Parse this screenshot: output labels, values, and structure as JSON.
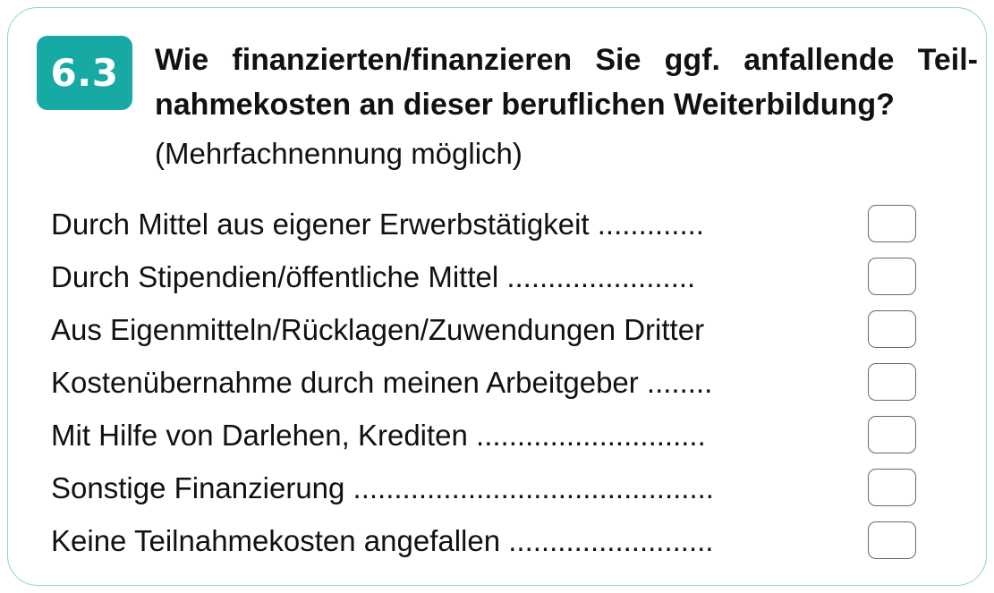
{
  "question": {
    "number": "6.3",
    "line1": "Wie finanzierten/finanzieren Sie ggf. anfallende Teil-",
    "line2": "nahmekosten an dieser beruflichen Weiterbildung?",
    "hint": "(Mehrfachnennung möglich)"
  },
  "options": [
    {
      "label": "Durch Mittel aus eigener Erwerbstätigkeit .............",
      "checked": false
    },
    {
      "label": "Durch Stipendien/öffentliche Mittel .......................",
      "checked": false
    },
    {
      "label": "Aus Eigenmitteln/Rücklagen/Zuwendungen Dritter",
      "checked": false
    },
    {
      "label": "Kostenübernahme durch meinen Arbeitgeber ........",
      "checked": false
    },
    {
      "label": "Mit Hilfe von Darlehen, Krediten ............................",
      "checked": false
    },
    {
      "label": "Sonstige Finanzierung ............................................",
      "checked": false
    },
    {
      "label": "Keine Teilnahmekosten angefallen .........................",
      "checked": false
    }
  ],
  "colors": {
    "accent": "#17a9a3",
    "border": "#8fd3d1"
  }
}
